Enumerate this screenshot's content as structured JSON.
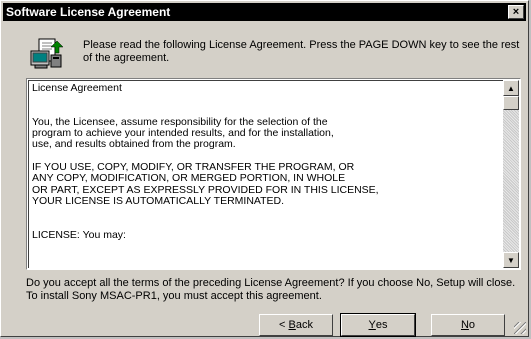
{
  "window": {
    "title": "Software License Agreement",
    "close_glyph": "×"
  },
  "header": {
    "icon": "computer-install-icon",
    "instructions": "Please read the following License Agreement.  Press the PAGE DOWN key to see the rest of the agreement."
  },
  "license": {
    "text": "License Agreement\n\n\nYou, the Licensee, assume responsibility for the selection of the\nprogram to achieve your intended results, and for the installation,\nuse, and results obtained from the program.\n\nIF YOU USE, COPY, MODIFY, OR TRANSFER THE PROGRAM, OR\nANY COPY, MODIFICATION, OR MERGED PORTION, IN WHOLE\nOR PART, EXCEPT AS EXPRESSLY PROVIDED FOR IN THIS LICENSE,\nYOUR LICENSE IS AUTOMATICALLY TERMINATED.\n\n\nLICENSE: You may:",
    "scroll_up_glyph": "▲",
    "scroll_down_glyph": "▼"
  },
  "question": "Do you accept all the terms of the preceding License Agreement?  If you choose No,  Setup will close.  To install Sony MSAC-PR1, you must accept this agreement.",
  "buttons": {
    "back_prefix": "< ",
    "back_hotkey": "B",
    "back_rest": "ack",
    "yes_hotkey": "Y",
    "yes_rest": "es",
    "no_hotkey": "N",
    "no_rest": "o"
  }
}
